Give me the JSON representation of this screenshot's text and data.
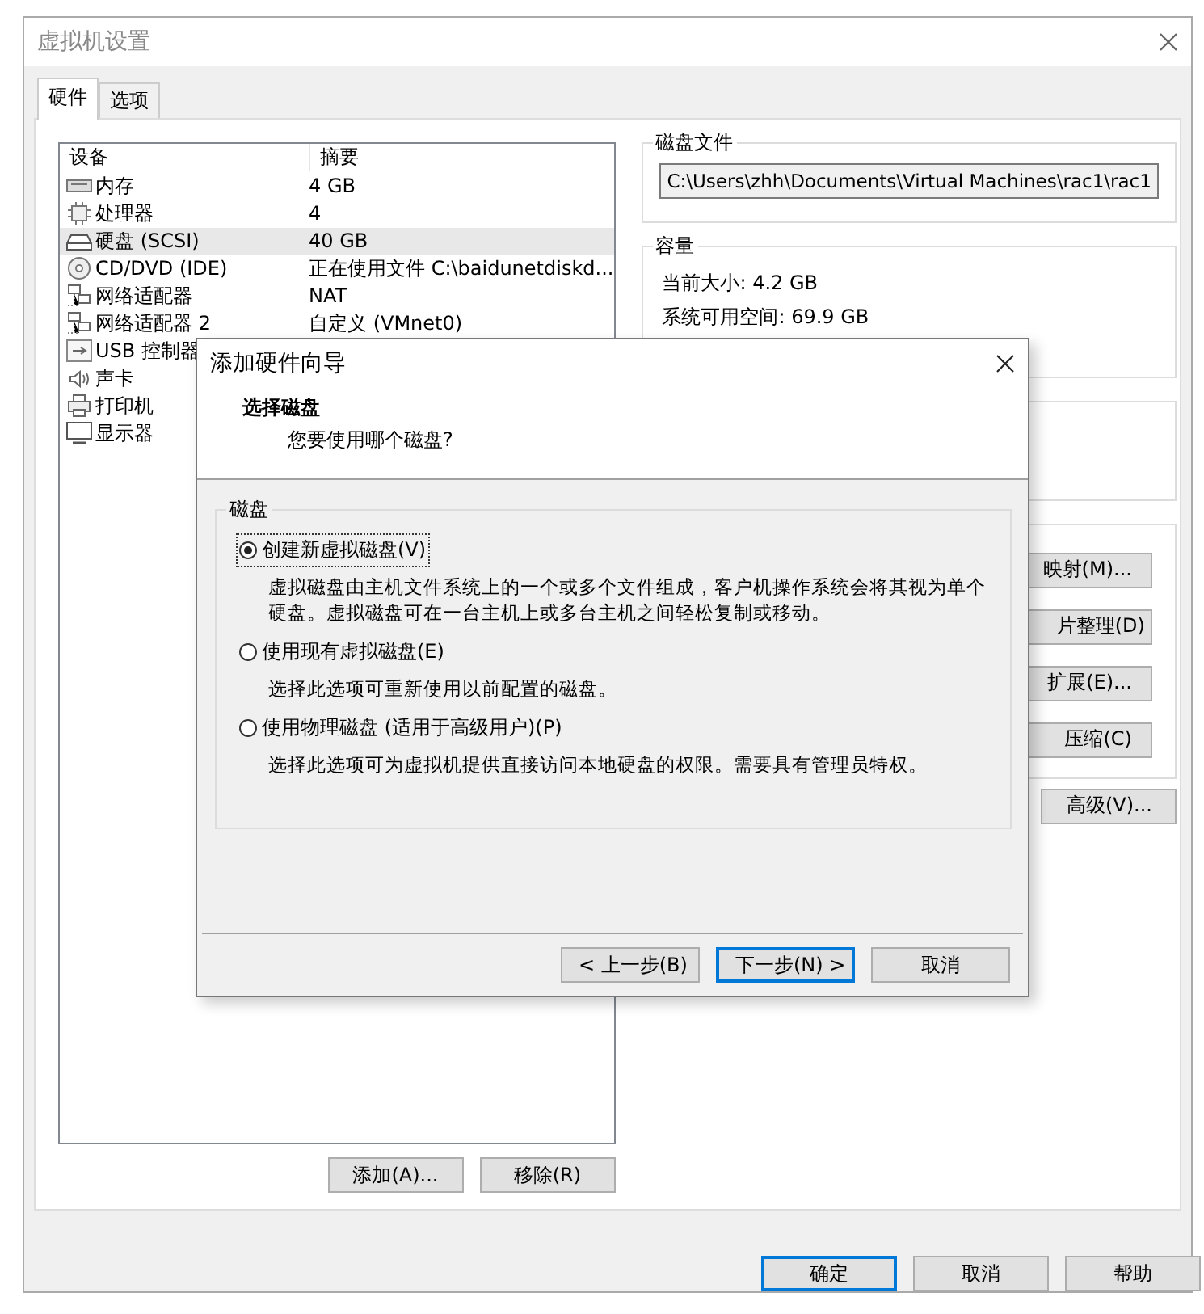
{
  "window": {
    "title": "虚拟机设置"
  },
  "tabs": [
    {
      "label": "硬件",
      "selected": true
    },
    {
      "label": "选项",
      "selected": false
    }
  ],
  "devices": {
    "columns": [
      "设备",
      "摘要"
    ],
    "rows": [
      {
        "kind": "memory",
        "name": "内存",
        "summary": "4 GB",
        "selected": false
      },
      {
        "kind": "cpu",
        "name": "处理器",
        "summary": "4",
        "selected": false
      },
      {
        "kind": "disk",
        "name": "硬盘 (SCSI)",
        "summary": "40 GB",
        "selected": true
      },
      {
        "kind": "cd",
        "name": "CD/DVD (IDE)",
        "summary": "正在使用文件 C:\\baidunetdiskd...",
        "selected": false
      },
      {
        "kind": "net",
        "name": "网络适配器",
        "summary": "NAT",
        "selected": false
      },
      {
        "kind": "net",
        "name": "网络适配器 2",
        "summary": "自定义 (VMnet0)",
        "selected": false
      },
      {
        "kind": "usb",
        "name": "USB 控制器",
        "selected": false
      },
      {
        "kind": "sound",
        "name": "声卡",
        "selected": false
      },
      {
        "kind": "printer",
        "name": "打印机",
        "selected": false
      },
      {
        "kind": "display",
        "name": "显示器",
        "selected": false
      }
    ],
    "buttons": [
      "添加(A)...",
      "移除(R)"
    ]
  },
  "disk_file": {
    "label": "磁盘文件",
    "value": "C:\\Users\\zhh\\Documents\\Virtual Machines\\rac1\\rac1"
  },
  "capacity": {
    "label": "容量",
    "lines": [
      "当前大小: 4.2 GB",
      "系统可用空间: 69.9 GB"
    ]
  },
  "utility_buttons": [
    "映射(M)...",
    "片整理(D)",
    "扩展(E)...",
    "压缩(C)"
  ],
  "advanced_button": "高级(V)...",
  "footer_buttons": [
    {
      "label": "确定",
      "default": true
    },
    {
      "label": "取消",
      "default": false
    },
    {
      "label": "帮助",
      "default": false
    }
  ],
  "dialog": {
    "title": "添加硬件向导",
    "heading": "选择磁盘",
    "subheading": "您要使用哪个磁盘?",
    "group": "磁盘",
    "options": [
      {
        "label": "创建新虚拟磁盘(V)",
        "description": "虚拟磁盘由主机文件系统上的一个或多个文件组成，客户机操作系统会将其视为单个硬盘。虚拟磁盘可在一台主机上或多台主机之间轻松复制或移动。",
        "selected": true
      },
      {
        "label": "使用现有虚拟磁盘(E)",
        "description": "选择此选项可重新使用以前配置的磁盘。",
        "selected": false
      },
      {
        "label": "使用物理磁盘 (适用于高级用户)(P)",
        "description": "选择此选项可为虚拟机提供直接访问本地硬盘的权限。需要具有管理员特权。",
        "selected": false
      }
    ],
    "buttons": [
      {
        "label": "< 上一步(B)",
        "default": false
      },
      {
        "label": "下一步(N) >",
        "default": true
      },
      {
        "label": "取消",
        "default": false
      }
    ]
  }
}
